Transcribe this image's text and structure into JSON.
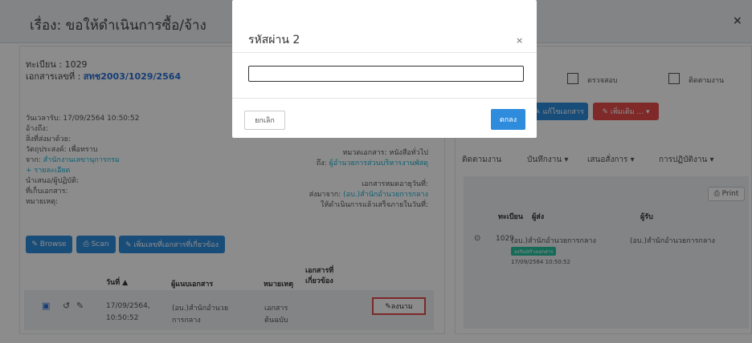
{
  "header": {
    "title": "เรื่อง: ขอให้ดำเนินการซื้อ/จ้าง",
    "close": "×"
  },
  "doc": {
    "reg_label": "ทะเบียน : 1029",
    "docno_label": "เอกสารเลขที่ : ",
    "docno_value": "สทช2003/1029/2564",
    "received": "วันเวลารับ: 17/09/2564 10:50:52",
    "refer": "อ้างถึง:",
    "attach": "สิ่งที่ส่งมาด้วย:",
    "purpose": "วัตถุประสงค์: เพื่อทราบ",
    "from_label": "จาก: ",
    "from_value": "สำนักงานเลขานุการกรม",
    "more": "+ รายละเอียด",
    "propose": "นำเสนอ/ผู้ปฏิบัติ:",
    "store": "ที่เก็บเอกสาร:",
    "note": "หมายเหตุ:",
    "category": "หมวดเอกสาร: หนังสือทั่วไป",
    "to_label": "ถึง: ",
    "to_value": "ผู้อำนวยการส่วนบริหารงานพัสดุ",
    "expire": "เอกสารหมดอายุวันที่:",
    "sentfrom_label": "ส่งมาจาก: ",
    "sentfrom_value": "(อบ.)สำนักอำนวยการกลาง",
    "due": "ให้ดำเนินการแล้วเสร็จภายในวันที่:"
  },
  "buttons": {
    "browse": "✎ Browse",
    "scan": "⎙ Scan",
    "addref": "✎ เพิ่มเลขที่เอกสารที่เกี่ยวข้อง",
    "edit": "✎ แก้ไขเอกสาร",
    "more": "✎ เพิ่มเติม ... ▾",
    "print": "⎙ Print",
    "sign": "✎ลงนาม"
  },
  "checks": {
    "review": "ตรวจสอบ",
    "follow": "ติดตามงาน"
  },
  "file_table": {
    "headers": [
      "วันที่ ▲",
      "ผู้แนบเอกสาร",
      "หมายเหตุ",
      "เอกสารที่",
      "เกี่ยวข้อง"
    ],
    "row": {
      "date1": "17/09/2564,",
      "date2": "10:50:52",
      "by1": "(อบ.)สำนักอำนวย",
      "by2": "การกลาง",
      "note1": "เอกสาร",
      "note2": "ต้นฉบับ"
    }
  },
  "tabs": [
    "ติดตามงาน",
    "บันทึกงาน ▾",
    "เสนอสั่งการ ▾",
    "การปฏิบัติงาน ▾"
  ],
  "track_table": {
    "headers": [
      "ทะเบียน",
      "ผู้ส่ง",
      "ผู้รับ"
    ],
    "row": {
      "reg": "1029",
      "sender": "(อบ.)สำนักอำนวยการกลาง",
      "receiver": "(อบ.)สำนักอำนวยการกลาง",
      "tag": "ลงรับ/สร้างเอกสาร",
      "time": "17/09/2564 10:50:52"
    }
  },
  "modal": {
    "title": "รหัสผ่าน 2",
    "close": "×",
    "input_value": "",
    "cancel": "ยกเลิก",
    "ok": "ตกลง"
  }
}
